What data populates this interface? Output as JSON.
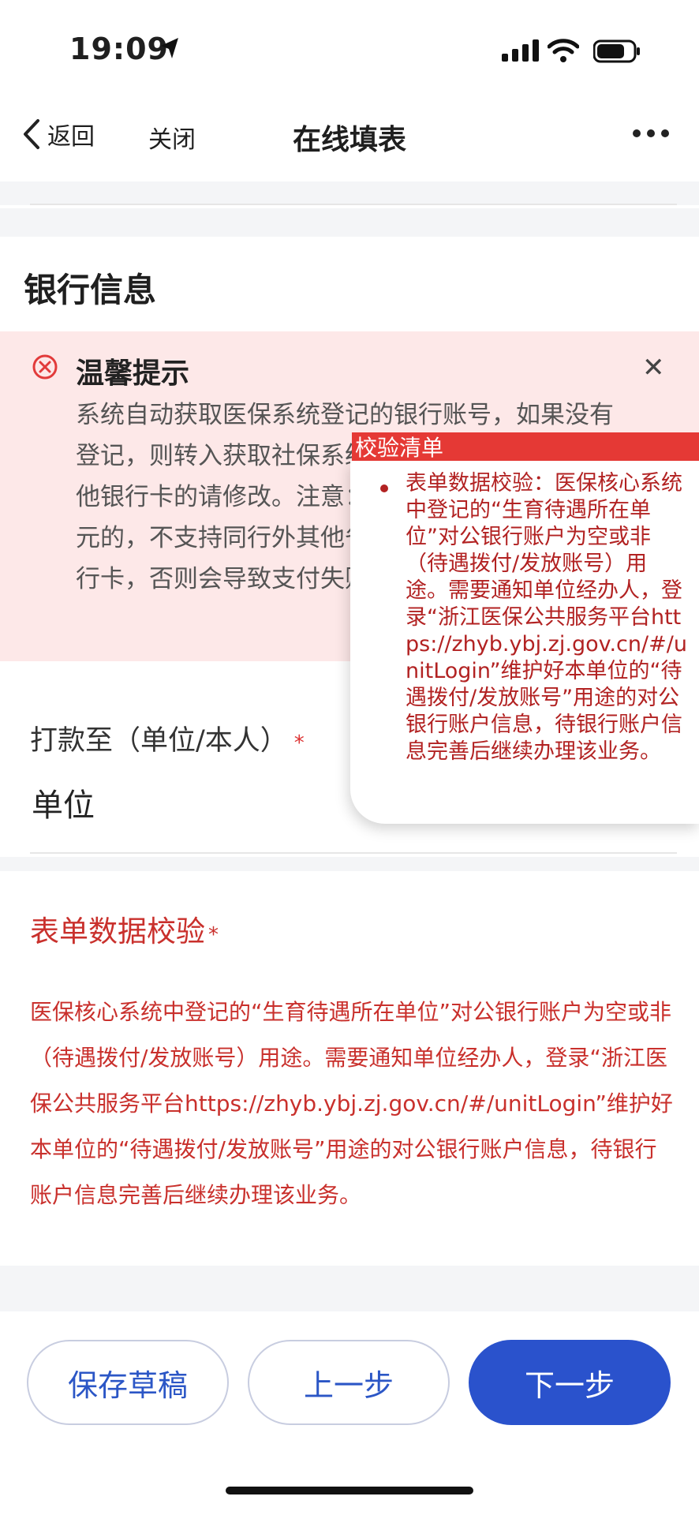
{
  "status_bar": {
    "time": "19:09",
    "icons": [
      "location-arrow-icon",
      "signal-icon",
      "wifi-icon",
      "battery-icon"
    ]
  },
  "navbar": {
    "back_label": "返回",
    "close_label": "关闭",
    "title": "在线填表",
    "more_icon": "more-icon"
  },
  "section": {
    "title": "银行信息"
  },
  "tip": {
    "title": "温馨提示",
    "text": "系统自动获取医保系统登记的银行账号，如果没有登记，则转入获取社保系统银行账号。如需选择其他银行卡的请修改。注意：单笔报销金额超过1万元的，不支持同行外其他省外开户银行卡及II类银行卡，否则会导致支付失败。"
  },
  "payto": {
    "label": "打款至（单位/本人）",
    "required_mark": "*",
    "value": "单位"
  },
  "validation": {
    "label": "表单数据校验",
    "required_mark": "*",
    "text": "医保核心系统中登记的“生育待遇所在单位”对公银行账户为空或非（待遇拨付/发放账号）用途。需要通知单位经办人，登录“浙江医保公共服务平台https://zhyb.ybj.zj.gov.cn/#/unitLogin”维护好本单位的“待遇拨付/发放账号”用途的对公银行账户信息，待银行账户信息完善后继续办理该业务。"
  },
  "popup": {
    "title": "校验清单",
    "item": "表单数据校验：医保核心系统中登记的“生育待遇所在单位”对公银行账户为空或非（待遇拨付/发放账号）用途。需要通知单位经办人，登录“浙江医保公共服务平台https://zhyb.ybj.zj.gov.cn/#/unitLogin”维护好本单位的“待遇拨付/发放账号”用途的对公银行账户信息，待银行账户信息完善后继续办理该业务。"
  },
  "buttons": {
    "save_draft": "保存草稿",
    "prev": "上一步",
    "next": "下一步"
  },
  "colors": {
    "accent": "#2a52cc",
    "error": "#c9302c",
    "tip_bg": "#fde8e8"
  }
}
